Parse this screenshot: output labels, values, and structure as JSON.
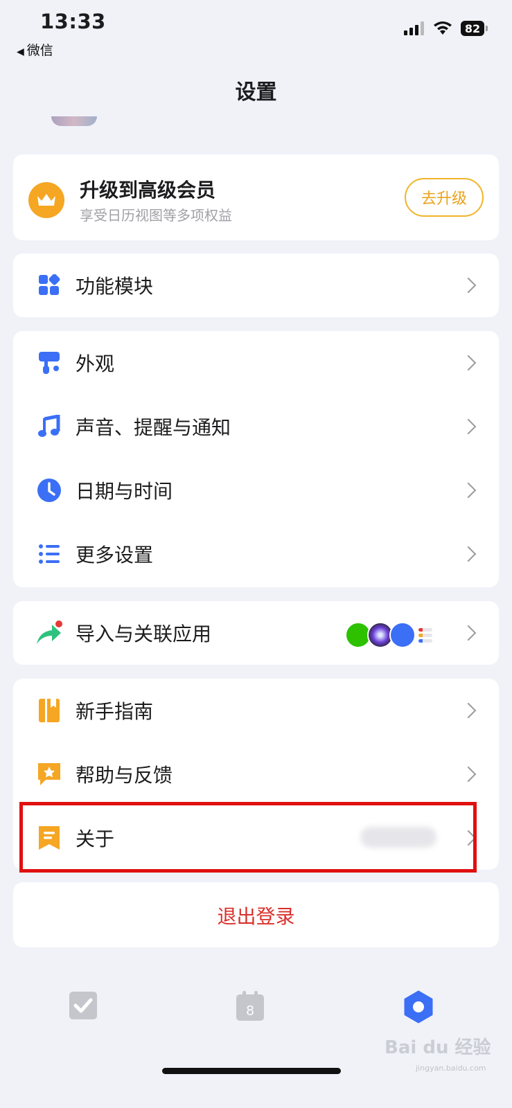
{
  "status_bar": {
    "time": "13:33",
    "back_app": "微信",
    "battery": "82"
  },
  "nav": {
    "title": "设置"
  },
  "upgrade": {
    "title": "升级到高级会员",
    "subtitle": "享受日历视图等多项权益",
    "button": "去升级",
    "icon": "crown-icon"
  },
  "modules": {
    "label": "功能模块",
    "icon": "grid-icon"
  },
  "settings_group": [
    {
      "label": "外观",
      "icon": "paint-roller-icon"
    },
    {
      "label": "声音、提醒与通知",
      "icon": "music-note-icon"
    },
    {
      "label": "日期与时间",
      "icon": "clock-icon"
    },
    {
      "label": "更多设置",
      "icon": "list-settings-icon"
    }
  ],
  "import": {
    "label": "导入与关联应用",
    "icon": "share-arrow-icon",
    "apps": [
      "wechat-icon",
      "siri-icon",
      "calendar-icon",
      "reminders-icon"
    ]
  },
  "help_group": [
    {
      "label": "新手指南",
      "icon": "book-icon"
    },
    {
      "label": "帮助与反馈",
      "icon": "feedback-icon"
    },
    {
      "label": "关于",
      "icon": "bookmark-icon"
    }
  ],
  "logout": {
    "label": "退出登录"
  },
  "tabbar": [
    {
      "name": "tasks",
      "icon": "checkbox-icon"
    },
    {
      "name": "calendar",
      "icon": "calendar-8-icon",
      "day": "8"
    },
    {
      "name": "settings",
      "icon": "hexagon-settings-icon"
    }
  ],
  "watermark": {
    "text": "Bai du 经验",
    "url": "jingyan.baidu.com"
  },
  "colors": {
    "accent_blue": "#3b6ff5",
    "gold": "#f5a623",
    "logout_red": "#d9302b",
    "highlight_red": "#e01010"
  }
}
